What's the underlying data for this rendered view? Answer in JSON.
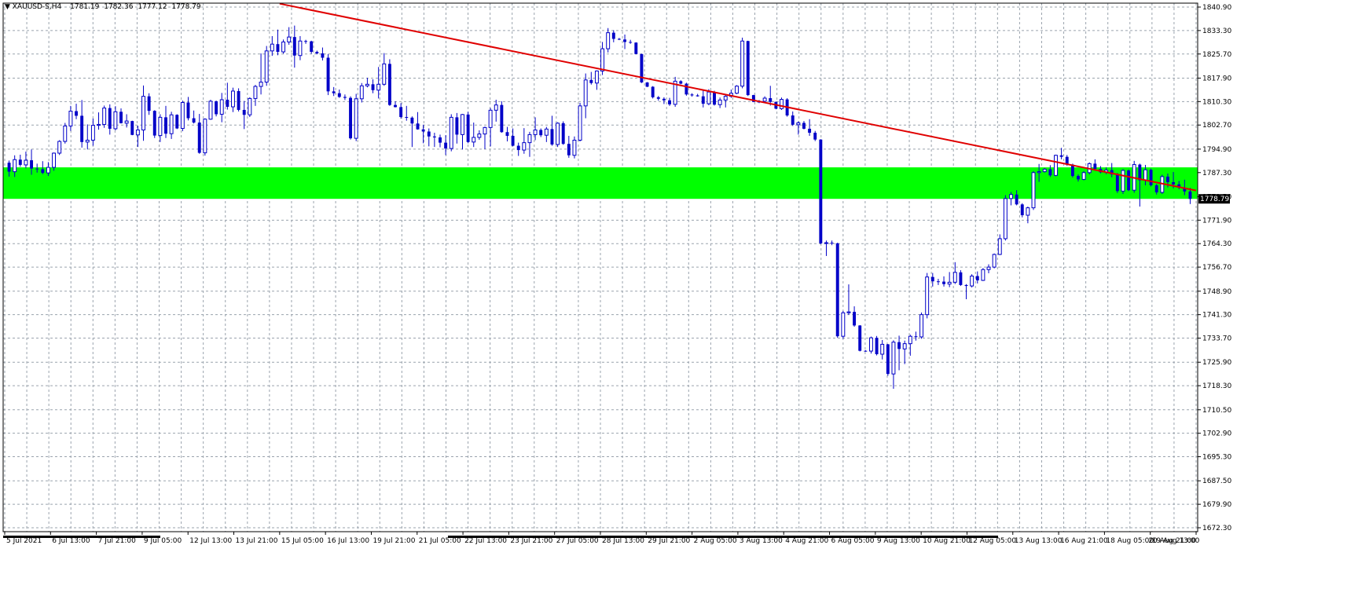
{
  "header": {
    "symbol": "XAUUSD-S,H4",
    "open": "1781.19",
    "high": "1782.36",
    "low": "1777.12",
    "close": "1778.79"
  },
  "price_tag": "1778.79",
  "chart_data": {
    "type": "candlestick",
    "title": "XAUUSD-S,H4",
    "y_ticks": [
      "1840.90",
      "1833.30",
      "1825.70",
      "1817.90",
      "1810.30",
      "1802.70",
      "1794.90",
      "1787.30",
      "1779.50",
      "1771.90",
      "1764.30",
      "1756.70",
      "1748.90",
      "1741.30",
      "1733.70",
      "1725.90",
      "1718.30",
      "1710.50",
      "1702.90",
      "1695.30",
      "1687.50",
      "1679.90",
      "1672.30"
    ],
    "ylim": [
      1672.3,
      1840.9
    ],
    "x_ticks": [
      "5 Jul 2021",
      "6 Jul 13:00",
      "7 Jul 21:00",
      "9 Jul 05:00",
      "12 Jul 13:00",
      "13 Jul 21:00",
      "15 Jul 05:00",
      "16 Jul 13:00",
      "19 Jul 21:00",
      "21 Jul 05:00",
      "22 Jul 13:00",
      "23 Jul 21:00",
      "27 Jul 05:00",
      "28 Jul 13:00",
      "29 Jul 21:00",
      "2 Aug 05:00",
      "3 Aug 13:00",
      "4 Aug 21:00",
      "6 Aug 05:00",
      "9 Aug 13:00",
      "10 Aug 21:00",
      "12 Aug 05:00",
      "13 Aug 13:00",
      "16 Aug 21:00",
      "18 Aug 05:00",
      "19 Aug 13:00",
      "20 Aug 21:00"
    ],
    "bull_color": "#ffffff",
    "bear_color": "#0000c8",
    "wick_color": "#0000c8",
    "grid": true,
    "candles": [
      [
        1790.5,
        1791.2,
        1786.0,
        1787.6
      ],
      [
        1787.6,
        1792.9,
        1785.9,
        1791.5
      ],
      [
        1791.5,
        1793.1,
        1789.2,
        1789.8
      ],
      [
        1789.8,
        1794.1,
        1788.7,
        1791.3
      ],
      [
        1791.3,
        1794.8,
        1786.6,
        1788.6
      ],
      [
        1788.6,
        1790.2,
        1787.3,
        1788.4
      ],
      [
        1788.4,
        1791.0,
        1786.8,
        1787.2
      ],
      [
        1787.2,
        1790.7,
        1786.2,
        1789.0
      ],
      [
        1789.0,
        1793.8,
        1787.9,
        1793.6
      ],
      [
        1793.6,
        1797.8,
        1793.0,
        1797.4
      ],
      [
        1797.4,
        1803.4,
        1796.7,
        1802.4
      ],
      [
        1802.4,
        1808.9,
        1800.8,
        1807.2
      ],
      [
        1807.2,
        1809.6,
        1804.6,
        1805.7
      ],
      [
        1805.7,
        1810.8,
        1795.4,
        1797.2
      ],
      [
        1797.2,
        1802.9,
        1794.8,
        1797.8
      ],
      [
        1797.8,
        1804.8,
        1796.0,
        1802.6
      ],
      [
        1802.6,
        1806.8,
        1801.2,
        1802.9
      ],
      [
        1802.9,
        1809.0,
        1801.8,
        1808.2
      ],
      [
        1808.2,
        1809.4,
        1799.6,
        1801.5
      ],
      [
        1801.5,
        1808.8,
        1801.0,
        1807.0
      ],
      [
        1807.0,
        1808.1,
        1803.2,
        1803.3
      ],
      [
        1803.3,
        1806.2,
        1801.9,
        1804.0
      ],
      [
        1804.0,
        1804.1,
        1799.4,
        1799.5
      ],
      [
        1799.5,
        1802.5,
        1795.6,
        1801.1
      ],
      [
        1801.1,
        1815.5,
        1797.6,
        1812.0
      ],
      [
        1812.0,
        1813.0,
        1806.0,
        1807.3
      ],
      [
        1807.3,
        1807.5,
        1798.5,
        1799.3
      ],
      [
        1799.3,
        1806.2,
        1797.2,
        1805.2
      ],
      [
        1805.2,
        1808.9,
        1798.5,
        1799.9
      ],
      [
        1799.9,
        1807.0,
        1798.2,
        1806.0
      ],
      [
        1806.0,
        1806.2,
        1801.4,
        1801.6
      ],
      [
        1801.6,
        1810.6,
        1800.7,
        1810.0
      ],
      [
        1810.0,
        1811.8,
        1804.2,
        1804.9
      ],
      [
        1804.9,
        1807.4,
        1803.2,
        1803.5
      ],
      [
        1803.5,
        1806.3,
        1793.4,
        1793.7
      ],
      [
        1793.7,
        1804.9,
        1792.8,
        1804.6
      ],
      [
        1804.6,
        1810.9,
        1804.4,
        1810.4
      ],
      [
        1810.4,
        1810.6,
        1805.5,
        1806.2
      ],
      [
        1806.2,
        1813.1,
        1803.6,
        1810.9
      ],
      [
        1810.9,
        1816.4,
        1807.7,
        1808.6
      ],
      [
        1808.6,
        1814.8,
        1806.9,
        1813.7
      ],
      [
        1813.7,
        1814.6,
        1807.1,
        1807.6
      ],
      [
        1807.6,
        1810.5,
        1801.4,
        1806.0
      ],
      [
        1806.0,
        1811.7,
        1805.3,
        1811.3
      ],
      [
        1811.3,
        1815.7,
        1808.9,
        1815.2
      ],
      [
        1815.2,
        1825.9,
        1812.6,
        1816.6
      ],
      [
        1816.6,
        1828.3,
        1815.4,
        1826.7
      ],
      [
        1826.7,
        1831.5,
        1825.1,
        1828.9
      ],
      [
        1828.9,
        1833.6,
        1825.3,
        1826.4
      ],
      [
        1826.4,
        1830.4,
        1825.8,
        1829.6
      ],
      [
        1829.6,
        1834.4,
        1828.7,
        1831.2
      ],
      [
        1831.2,
        1834.9,
        1821.3,
        1825.2
      ],
      [
        1825.2,
        1831.5,
        1823.7,
        1829.9
      ],
      [
        1829.9,
        1830.3,
        1829.0,
        1829.8
      ],
      [
        1829.8,
        1830.0,
        1825.8,
        1826.4
      ],
      [
        1826.4,
        1826.8,
        1825.6,
        1825.9
      ],
      [
        1825.9,
        1827.8,
        1823.6,
        1824.5
      ],
      [
        1824.5,
        1825.7,
        1812.4,
        1813.6
      ],
      [
        1813.6,
        1815.0,
        1812.1,
        1813.0
      ],
      [
        1813.0,
        1814.2,
        1811.5,
        1811.8
      ],
      [
        1811.8,
        1812.6,
        1810.8,
        1811.5
      ],
      [
        1811.5,
        1812.0,
        1798.0,
        1798.4
      ],
      [
        1798.4,
        1812.8,
        1797.5,
        1811.2
      ],
      [
        1811.2,
        1816.3,
        1810.0,
        1815.4
      ],
      [
        1815.4,
        1818.0,
        1814.9,
        1815.9
      ],
      [
        1815.9,
        1817.5,
        1813.0,
        1814.0
      ],
      [
        1814.0,
        1821.5,
        1811.3,
        1815.9
      ],
      [
        1815.9,
        1826.0,
        1815.4,
        1822.5
      ],
      [
        1822.5,
        1824.0,
        1808.9,
        1809.2
      ],
      [
        1809.2,
        1810.4,
        1808.4,
        1808.5
      ],
      [
        1808.5,
        1809.8,
        1804.8,
        1805.3
      ],
      [
        1805.3,
        1808.9,
        1804.1,
        1805.1
      ],
      [
        1805.1,
        1805.5,
        1795.6,
        1803.2
      ],
      [
        1803.2,
        1806.9,
        1801.2,
        1801.3
      ],
      [
        1801.3,
        1802.8,
        1796.8,
        1800.6
      ],
      [
        1800.6,
        1801.6,
        1795.8,
        1799.0
      ],
      [
        1799.0,
        1800.2,
        1795.6,
        1798.7
      ],
      [
        1798.7,
        1799.6,
        1795.5,
        1797.0
      ],
      [
        1797.0,
        1799.4,
        1793.0,
        1795.1
      ],
      [
        1795.1,
        1806.2,
        1794.2,
        1805.2
      ],
      [
        1805.2,
        1806.6,
        1796.7,
        1799.6
      ],
      [
        1799.6,
        1806.3,
        1794.8,
        1806.1
      ],
      [
        1806.1,
        1807.0,
        1796.8,
        1797.2
      ],
      [
        1797.2,
        1803.5,
        1795.6,
        1798.7
      ],
      [
        1798.7,
        1801.0,
        1797.9,
        1799.8
      ],
      [
        1799.8,
        1802.2,
        1794.9,
        1801.9
      ],
      [
        1801.9,
        1808.2,
        1795.8,
        1807.5
      ],
      [
        1807.5,
        1810.9,
        1803.8,
        1809.2
      ],
      [
        1809.2,
        1810.4,
        1800.2,
        1800.4
      ],
      [
        1800.4,
        1802.1,
        1797.4,
        1799.2
      ],
      [
        1799.2,
        1801.6,
        1795.8,
        1796.0
      ],
      [
        1796.0,
        1797.0,
        1792.7,
        1794.6
      ],
      [
        1794.6,
        1801.7,
        1793.4,
        1797.0
      ],
      [
        1797.0,
        1800.5,
        1792.4,
        1799.6
      ],
      [
        1799.6,
        1805.2,
        1797.8,
        1801.1
      ],
      [
        1801.1,
        1801.6,
        1798.8,
        1799.4
      ],
      [
        1799.4,
        1802.1,
        1797.2,
        1801.4
      ],
      [
        1801.4,
        1805.7,
        1796.0,
        1796.4
      ],
      [
        1796.4,
        1803.6,
        1795.6,
        1803.3
      ],
      [
        1803.3,
        1803.9,
        1796.3,
        1796.6
      ],
      [
        1796.6,
        1799.2,
        1792.1,
        1792.9
      ],
      [
        1792.9,
        1799.0,
        1791.9,
        1797.8
      ],
      [
        1797.8,
        1809.9,
        1797.4,
        1808.9
      ],
      [
        1808.9,
        1819.4,
        1804.9,
        1817.3
      ],
      [
        1817.3,
        1819.9,
        1815.8,
        1816.3
      ],
      [
        1816.3,
        1820.4,
        1814.1,
        1820.2
      ],
      [
        1820.2,
        1829.6,
        1818.9,
        1827.4
      ],
      [
        1827.4,
        1834.1,
        1826.2,
        1832.6
      ],
      [
        1832.6,
        1833.4,
        1829.5,
        1830.6
      ],
      [
        1830.6,
        1830.9,
        1830.2,
        1830.4
      ],
      [
        1830.4,
        1832.0,
        1827.3,
        1829.6
      ],
      [
        1829.6,
        1830.3,
        1829.0,
        1829.4
      ],
      [
        1829.4,
        1829.5,
        1825.6,
        1825.7
      ],
      [
        1825.7,
        1825.8,
        1816.3,
        1816.5
      ],
      [
        1816.5,
        1816.6,
        1815.0,
        1815.1
      ],
      [
        1815.1,
        1815.3,
        1811.3,
        1811.7
      ],
      [
        1811.7,
        1812.1,
        1810.6,
        1811.2
      ],
      [
        1811.2,
        1811.7,
        1809.5,
        1810.7
      ],
      [
        1810.7,
        1811.5,
        1808.9,
        1809.4
      ],
      [
        1809.4,
        1818.3,
        1808.6,
        1816.9
      ],
      [
        1816.9,
        1817.2,
        1815.9,
        1816.1
      ],
      [
        1816.1,
        1816.4,
        1812.2,
        1812.6
      ],
      [
        1812.6,
        1813.0,
        1811.9,
        1812.3
      ],
      [
        1812.3,
        1812.8,
        1811.9,
        1812.0
      ],
      [
        1812.0,
        1813.9,
        1808.4,
        1809.6
      ],
      [
        1809.6,
        1814.3,
        1809.1,
        1813.4
      ],
      [
        1813.4,
        1813.8,
        1809.0,
        1809.3
      ],
      [
        1809.3,
        1811.6,
        1808.2,
        1810.8
      ],
      [
        1810.8,
        1812.5,
        1808.4,
        1812.0
      ],
      [
        1812.0,
        1814.2,
        1811.5,
        1813.0
      ],
      [
        1813.0,
        1815.6,
        1812.7,
        1815.3
      ],
      [
        1815.3,
        1831.0,
        1814.6,
        1829.9
      ],
      [
        1829.9,
        1830.0,
        1812.1,
        1812.4
      ],
      [
        1812.4,
        1812.5,
        1810.1,
        1810.2
      ],
      [
        1810.2,
        1810.8,
        1809.8,
        1810.4
      ],
      [
        1810.4,
        1812.0,
        1809.9,
        1811.4
      ],
      [
        1811.4,
        1815.4,
        1809.0,
        1810.2
      ],
      [
        1810.2,
        1810.3,
        1807.8,
        1808.0
      ],
      [
        1808.0,
        1811.6,
        1807.6,
        1811.0
      ],
      [
        1811.0,
        1811.4,
        1805.4,
        1805.8
      ],
      [
        1805.8,
        1807.1,
        1802.4,
        1802.8
      ],
      [
        1802.8,
        1803.9,
        1799.6,
        1803.4
      ],
      [
        1803.4,
        1804.0,
        1801.3,
        1801.5
      ],
      [
        1801.5,
        1804.6,
        1799.2,
        1800.2
      ],
      [
        1800.2,
        1800.8,
        1797.5,
        1798.0
      ],
      [
        1798.0,
        1798.1,
        1764.1,
        1764.4
      ],
      [
        1764.4,
        1765.3,
        1760.3,
        1764.6
      ],
      [
        1764.6,
        1765.3,
        1763.8,
        1764.4
      ],
      [
        1764.4,
        1764.6,
        1733.8,
        1734.3
      ],
      [
        1734.3,
        1742.5,
        1733.5,
        1741.9
      ],
      [
        1741.9,
        1751.1,
        1741.2,
        1742.2
      ],
      [
        1742.2,
        1744.0,
        1737.4,
        1737.8
      ],
      [
        1737.8,
        1737.9,
        1729.4,
        1729.6
      ],
      [
        1729.6,
        1729.8,
        1729.3,
        1729.5
      ],
      [
        1729.5,
        1734.2,
        1728.7,
        1733.8
      ],
      [
        1733.8,
        1734.4,
        1728.1,
        1728.5
      ],
      [
        1728.5,
        1733.1,
        1726.8,
        1731.7
      ],
      [
        1731.7,
        1731.8,
        1721.5,
        1722.1
      ],
      [
        1722.1,
        1733.0,
        1717.3,
        1732.4
      ],
      [
        1732.4,
        1734.5,
        1723.3,
        1730.2
      ],
      [
        1730.2,
        1732.9,
        1725.3,
        1731.9
      ],
      [
        1731.9,
        1734.8,
        1728.0,
        1734.3
      ],
      [
        1734.3,
        1735.8,
        1732.9,
        1734.1
      ],
      [
        1734.1,
        1742.0,
        1733.5,
        1741.3
      ],
      [
        1741.3,
        1754.8,
        1740.1,
        1753.5
      ],
      [
        1753.5,
        1754.8,
        1750.4,
        1752.1
      ],
      [
        1752.1,
        1752.9,
        1750.9,
        1752.0
      ],
      [
        1752.0,
        1753.7,
        1750.4,
        1751.2
      ],
      [
        1751.2,
        1755.1,
        1750.2,
        1751.8
      ],
      [
        1751.8,
        1758.3,
        1751.2,
        1755.0
      ],
      [
        1755.0,
        1755.7,
        1750.6,
        1750.9
      ],
      [
        1750.9,
        1751.2,
        1746.3,
        1750.6
      ],
      [
        1750.6,
        1754.4,
        1750.1,
        1753.8
      ],
      [
        1753.8,
        1755.3,
        1751.4,
        1752.4
      ],
      [
        1752.4,
        1756.4,
        1752.2,
        1755.9
      ],
      [
        1755.9,
        1757.6,
        1754.7,
        1756.7
      ],
      [
        1756.7,
        1761.1,
        1756.3,
        1760.8
      ],
      [
        1760.8,
        1767.3,
        1760.6,
        1765.9
      ],
      [
        1765.9,
        1780.0,
        1765.3,
        1778.9
      ],
      [
        1778.9,
        1781.0,
        1776.7,
        1780.2
      ],
      [
        1780.2,
        1781.6,
        1776.7,
        1777.0
      ],
      [
        1777.0,
        1777.4,
        1772.8,
        1773.5
      ],
      [
        1773.5,
        1776.3,
        1770.9,
        1775.9
      ],
      [
        1775.9,
        1787.8,
        1775.2,
        1787.3
      ],
      [
        1787.3,
        1790.1,
        1784.3,
        1787.6
      ],
      [
        1787.6,
        1788.8,
        1787.3,
        1788.4
      ],
      [
        1788.4,
        1789.7,
        1785.9,
        1786.4
      ],
      [
        1786.4,
        1793.1,
        1786.1,
        1792.9
      ],
      [
        1792.9,
        1795.3,
        1791.6,
        1792.4
      ],
      [
        1792.4,
        1793.0,
        1789.5,
        1789.9
      ],
      [
        1789.9,
        1790.2,
        1785.7,
        1786.2
      ],
      [
        1786.2,
        1786.7,
        1784.4,
        1785.1
      ],
      [
        1785.1,
        1787.8,
        1784.8,
        1787.3
      ],
      [
        1787.3,
        1790.6,
        1786.7,
        1790.2
      ],
      [
        1790.2,
        1791.6,
        1787.9,
        1788.5
      ],
      [
        1788.5,
        1789.4,
        1787.1,
        1787.4
      ],
      [
        1787.4,
        1789.0,
        1786.8,
        1788.1
      ],
      [
        1788.1,
        1790.4,
        1785.8,
        1786.7
      ],
      [
        1786.7,
        1787.2,
        1780.7,
        1781.3
      ],
      [
        1781.3,
        1788.4,
        1780.4,
        1788.0
      ],
      [
        1788.0,
        1788.3,
        1781.3,
        1781.6
      ],
      [
        1781.6,
        1791.1,
        1780.8,
        1789.9
      ],
      [
        1789.9,
        1790.2,
        1776.3,
        1784.8
      ],
      [
        1784.8,
        1789.8,
        1783.2,
        1788.2
      ],
      [
        1788.2,
        1788.6,
        1782.8,
        1783.2
      ],
      [
        1783.2,
        1783.6,
        1780.2,
        1780.9
      ],
      [
        1780.9,
        1786.6,
        1780.4,
        1786.0
      ],
      [
        1786.0,
        1787.0,
        1782.5,
        1784.2
      ],
      [
        1784.2,
        1787.5,
        1782.2,
        1783.5
      ],
      [
        1783.5,
        1784.6,
        1781.9,
        1782.4
      ],
      [
        1782.4,
        1785.0,
        1780.0,
        1781.2
      ],
      [
        1781.19,
        1782.36,
        1777.12,
        1778.79
      ]
    ],
    "resistance_zone": [
      1778.8,
      1789.0
    ],
    "trendline": {
      "x": [
        "15 Jul 05:00",
        "20 Aug 21:00"
      ],
      "y": [
        1842.0,
        1781.5
      ],
      "color": "#e00000"
    },
    "zone_color": "#00ff00"
  }
}
